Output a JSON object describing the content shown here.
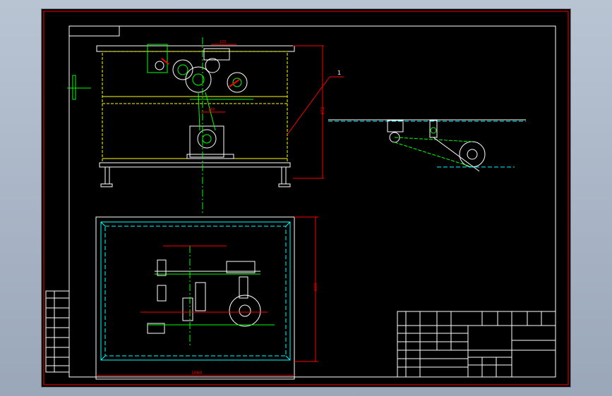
{
  "drawing": {
    "leader_label": "1",
    "dim_height_side": "372",
    "dim_height_plan": "600",
    "dim_width_plan": "1060",
    "dim_top_a": "120",
    "dim_top_b": "260"
  },
  "colors": {
    "background": "#000000",
    "border": "#ff0000",
    "frame": "#ffffff",
    "machine": "#ffff00",
    "parts": "#00ff00",
    "centerline": "#00ff00",
    "plan_frame": "#00ffff",
    "dimension": "#ff0000"
  }
}
